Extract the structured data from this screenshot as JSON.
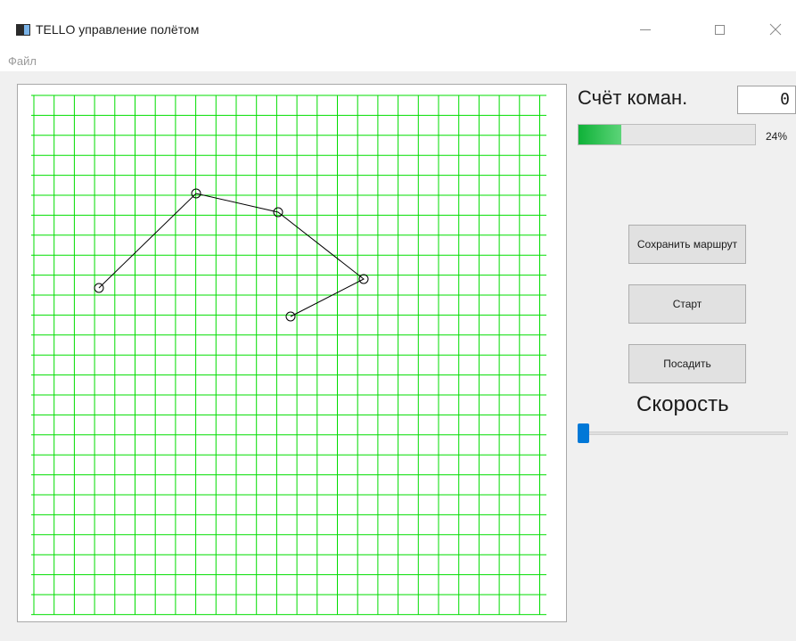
{
  "window": {
    "title": "TELLO управление полётом",
    "controls": {
      "minimize": "—",
      "maximize": "☐",
      "close": "✕"
    }
  },
  "menu": {
    "items": [
      "Файл"
    ]
  },
  "route": {
    "grid_color": "#00dd00",
    "line_color": "#000000",
    "waypoints": 5
  },
  "commands": {
    "label": "Счёт коман.",
    "value": "0"
  },
  "progress": {
    "value_percent": 24,
    "text": "24%",
    "color": "#1ec24a"
  },
  "buttons": {
    "save_route": "Сохранить маршрут",
    "start": "Старт",
    "land": "Посадить"
  },
  "speed": {
    "label": "Скорость",
    "slider_value_fraction": 0.0,
    "accent": "#0078d7"
  }
}
